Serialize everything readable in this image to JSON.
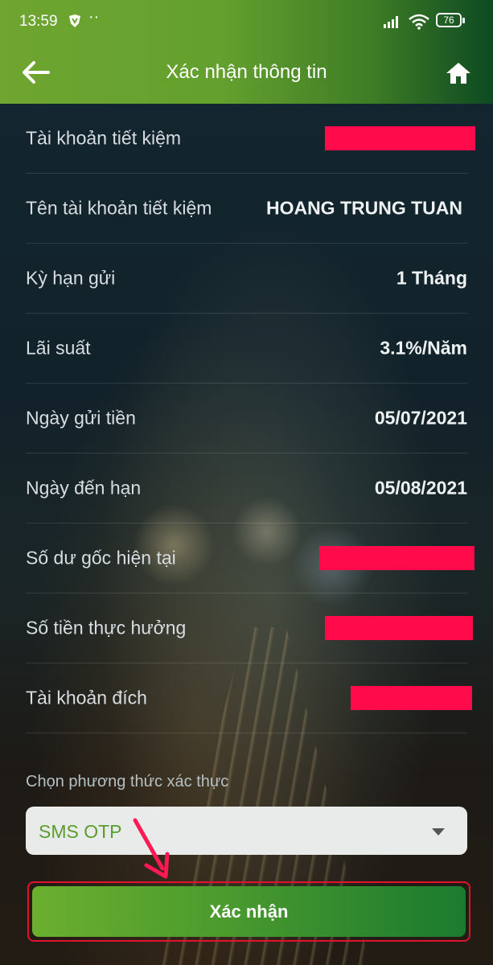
{
  "status_bar": {
    "time": "13:59",
    "battery": "76"
  },
  "header": {
    "title": "Xác nhận thông tin"
  },
  "rows": [
    {
      "label": "Tài khoản tiết kiệm",
      "value": ""
    },
    {
      "label": "Tên tài khoản tiết kiệm",
      "value": "HOANG TRUNG TUAN"
    },
    {
      "label": "Kỳ hạn gửi",
      "value": "1 Tháng"
    },
    {
      "label": "Lãi suất",
      "value": "3.1%/Năm"
    },
    {
      "label": "Ngày gửi tiền",
      "value": "05/07/2021"
    },
    {
      "label": "Ngày đến hạn",
      "value": "05/08/2021"
    },
    {
      "label": "Số dư gốc hiện tại",
      "value": ""
    },
    {
      "label": "Số tiền thực hưởng",
      "value": ""
    },
    {
      "label": "Tài khoản đích",
      "value": ""
    }
  ],
  "auth": {
    "label": "Chọn phương thức xác thực",
    "selected": "SMS OTP"
  },
  "confirm_button": {
    "label": "Xác nhận"
  },
  "colors": {
    "header_green": "#6fa530",
    "redaction": "#ff0a4b",
    "select_text_green": "#5a9d2c",
    "annotation_red": "#e0122d"
  },
  "icons": [
    "back-arrow-icon",
    "home-icon",
    "shield-icon",
    "wifi-icon",
    "signal-icon",
    "battery-icon",
    "chevron-down-icon"
  ]
}
